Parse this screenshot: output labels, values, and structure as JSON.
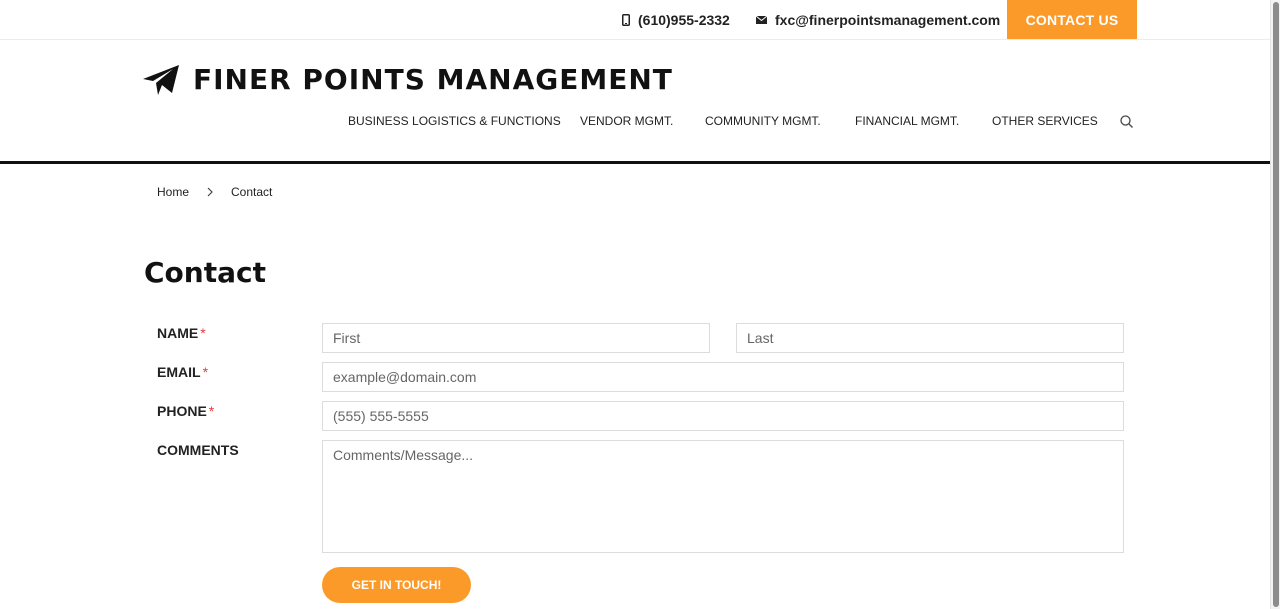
{
  "topbar": {
    "phone": "(610)955-2332",
    "email": "fxc@finerpointsmanagement.com",
    "contact_button": "CONTACT US",
    "phone_icon": "mobile-phone-icon",
    "email_icon": "envelope-icon"
  },
  "header": {
    "logo_icon": "paper-plane-icon",
    "logo_text": "FINER POINTS MANAGEMENT",
    "nav": [
      {
        "label": "BUSINESS LOGISTICS & FUNCTIONS"
      },
      {
        "label": "VENDOR MGMT."
      },
      {
        "label": "COMMUNITY MGMT."
      },
      {
        "label": "FINANCIAL MGMT."
      },
      {
        "label": "OTHER SERVICES"
      }
    ],
    "search_icon": "search-icon"
  },
  "breadcrumb": {
    "home": "Home",
    "current": "Contact"
  },
  "page": {
    "title": "Contact"
  },
  "form": {
    "required_mark": "*",
    "name_label": "NAME",
    "first_placeholder": "First",
    "last_placeholder": "Last",
    "email_label": "EMAIL",
    "email_placeholder": "example@domain.com",
    "phone_label": "PHONE",
    "phone_placeholder": "(555) 555-5555",
    "comments_label": "COMMENTS",
    "comments_placeholder": "Comments/Message...",
    "submit_label": "GET IN TOUCH!"
  },
  "colors": {
    "accent": "#fb9a28",
    "required": "#e23b3b",
    "text": "#222222"
  }
}
